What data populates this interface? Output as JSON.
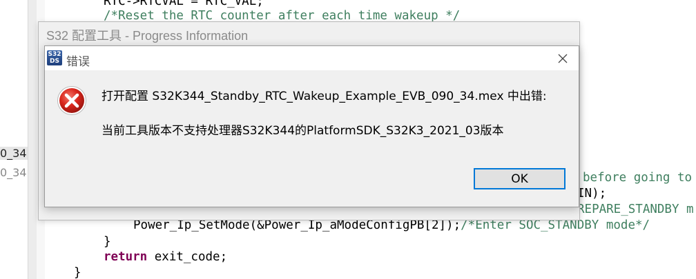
{
  "explorer": {
    "items": [
      "0_34.",
      "0_34."
    ]
  },
  "code": {
    "line_top": "RTC->RTCVAL = RTC_VAL;",
    "line_top_comment": "/*Reset the RTC counter after each time wakeup */",
    "line_r1": "before going to",
    "line_r2": "IN);",
    "line_r3": "REPARE_STANDBY m",
    "line_setmode": "Power_Ip_SetMode(&Power_Ip_aModeConfigPB[2]);",
    "line_setmode_comment": "/*Enter SOC_STANDBY mode*/",
    "line_brace1": "}",
    "line_return_kw": "return",
    "line_return_rest": " exit_code;",
    "line_brace2": "}"
  },
  "progress_window": {
    "title": "S32 配置工具 - Progress Information"
  },
  "dialog": {
    "app_icon_text_top": "S32",
    "app_icon_text_bottom": "DS",
    "title": "错误",
    "message_line1": "打开配置 S32K344_Standby_RTC_Wakeup_Example_EVB_090_34.mex 中出错:",
    "message_line2": "当前工具版本不支持处理器S32K344的PlatformSDK_S32K3_2021_03版本",
    "ok_label": "OK"
  },
  "colors": {
    "accent": "#0078d7",
    "error_red": "#d9261c",
    "comment_green": "#3f7f5f",
    "keyword_purple": "#7f0055"
  },
  "icons": {
    "close": "close-icon",
    "error": "error-icon",
    "app": "s32ds-app-icon"
  }
}
